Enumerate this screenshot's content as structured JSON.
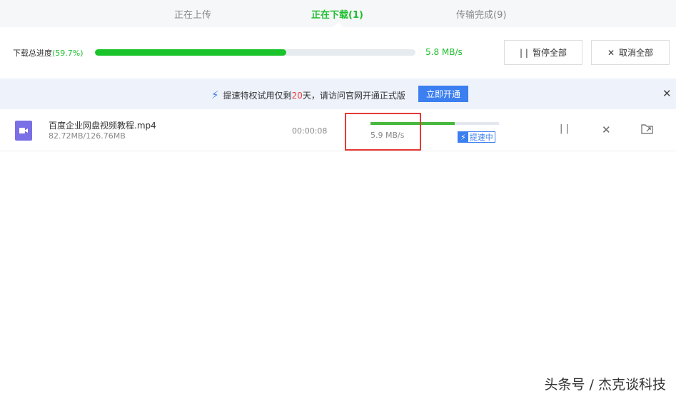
{
  "tabs": [
    {
      "label": "正在上传"
    },
    {
      "label": "正在下载(1)"
    },
    {
      "label": "传输完成(9)"
    }
  ],
  "total": {
    "label": "下载总进度",
    "percent_text": "(59.7%)",
    "percent": 59.7,
    "speed": "5.8 MB/s",
    "pause_all": "暂停全部",
    "cancel_all": "取消全部"
  },
  "banner": {
    "text_before": "提速特权试用仅剩",
    "days": "20",
    "text_after": "天，请访问官网开通正式版",
    "button": "立即开通"
  },
  "file": {
    "name": "百度企业网盘视频教程.mp4",
    "size": "82.72MB/126.76MB",
    "time": "00:00:08",
    "progress": 65.3,
    "speed": "5.9 MB/s",
    "boost_label": "提速中"
  },
  "watermark": "头条号 / 杰克谈科技",
  "colors": {
    "accent": "#1fbf2e",
    "blue": "#3b7ff0",
    "highlight": "#e53935"
  }
}
